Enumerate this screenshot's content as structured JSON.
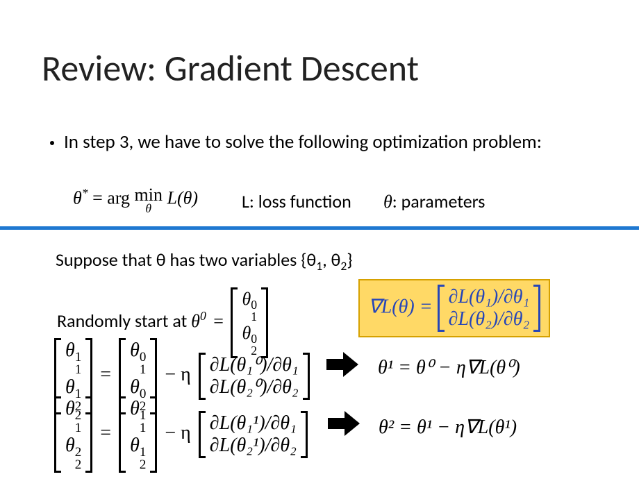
{
  "title": "Review: Gradient Descent",
  "bullet": "In step 3, we have to solve the following optimization problem:",
  "eq_argmin_lhs": "θ",
  "eq_argmin_star": "*",
  "eq_argmin_eq": " = arg ",
  "eq_argmin_min": "min",
  "eq_argmin_under": "θ",
  "eq_argmin_L": " L(θ)",
  "legend_L": "L: loss function",
  "legend_theta": "θ",
  "legend_params": ": parameters",
  "suppose_text": "Suppose that θ has two variables {θ",
  "suppose_s1": "1",
  "suppose_mid": ", θ",
  "suppose_s2": "2",
  "suppose_end": "}",
  "random_start": "Randomly start at ",
  "theta0": "θ",
  "sup0": "0",
  "eq": " = ",
  "m0r1": "θ",
  "m0r1_sup": "0",
  "m0r1_sub": "1",
  "m0r2": "θ",
  "m0r2_sup": "0",
  "m0r2_sub": "2",
  "grad_lhs": "∇L(θ) = ",
  "grad_r1": "∂L(θ₁)/∂θ₁",
  "grad_r2": "∂L(θ₂)/∂θ₂",
  "minus_eta": " − η ",
  "eqA": {
    "L_sup": "1",
    "R0_sup": "0",
    "p_r1": "∂L(θ₁⁰)/∂θ₁",
    "p_r2": "∂L(θ₂⁰)/∂θ₂"
  },
  "eqB": {
    "L_sup": "2",
    "R0_sup": "1",
    "p_r1": "∂L(θ₁¹)/∂θ₁",
    "p_r2": "∂L(θ₂¹)/∂θ₂"
  },
  "rhsA": "θ¹ = θ⁰ − η∇L(θ⁰)",
  "rhsB": "θ² = θ¹ − η∇L(θ¹)",
  "sub1": "1",
  "sub2": "2"
}
